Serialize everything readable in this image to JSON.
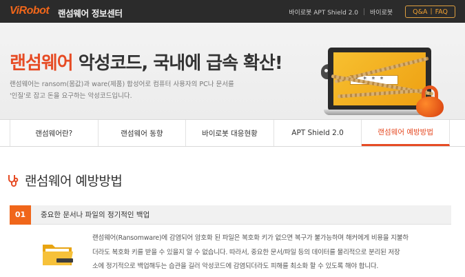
{
  "header": {
    "logo": "ViRobot",
    "site_title": "랜섬웨어 정보센터",
    "links": [
      "바이로봇 APT Shield 2.0",
      "바이로봇"
    ],
    "qa_label": "Q&A",
    "faq_label": "FAQ"
  },
  "hero": {
    "title_accent": "랜섬웨어",
    "title_rest": " 악성코드, 국내에 급속 확산!",
    "desc_line1": "랜섬웨어는 ransom(몸값)과 ware(제품) 합성어로 컴퓨터 사용자의 PC나 문서를",
    "desc_line2": "'인질'로 잡고 돈을 요구하는 악성코드입니다.",
    "password_mask": "* * * *"
  },
  "tabs": [
    {
      "label": "랜섬웨어란?"
    },
    {
      "label": "랜섬웨어 동향"
    },
    {
      "label": "바이로봇 대응현황"
    },
    {
      "label": "APT Shield 2.0"
    },
    {
      "label": "랜섬웨어 예방방법"
    }
  ],
  "active_tab": 4,
  "section": {
    "title": "랜섬웨어 예방방법"
  },
  "items": [
    {
      "number": "01",
      "title": "중요한 문서나 파일의 정기적인 백업",
      "body_line1": "랜섬웨어(Ransomware)에 감염되어 암호화 된 파일은 복호화 키가 없으면 복구가 불가능하며 해커에게 비용을 지불하",
      "body_line2": "더라도 복호화 키를 받을 수 있을지 알 수 없습니다. 따라서, 중요한 문서/파일 등의 데이터를 물리적으로 분리된 저장",
      "body_line3": "소에 정기적으로 백업해두는 습관을 길러 악성코드에 감염되더라도 피해를 최소화 할 수 있도록 해야 합니다."
    }
  ],
  "colors": {
    "accent": "#e64b24",
    "orange": "#f0661a",
    "topbar": "#2b2b2b"
  }
}
